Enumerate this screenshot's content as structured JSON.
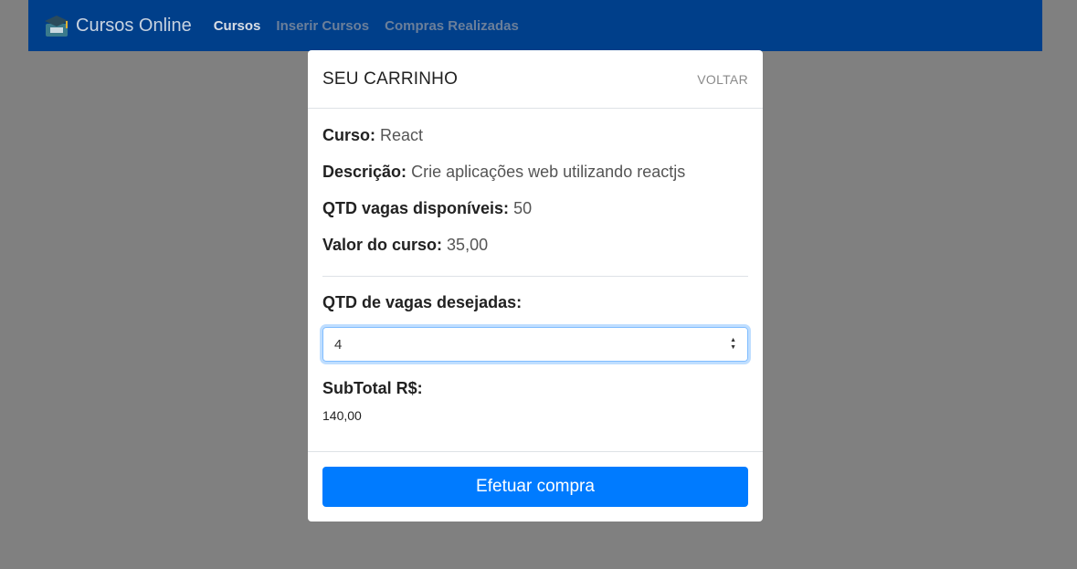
{
  "navbar": {
    "brand": "Cursos Online",
    "links": [
      "Cursos",
      "Inserir Cursos",
      "Compras Realizadas"
    ]
  },
  "modal": {
    "title": "SEU CARRINHO",
    "back_label": "VOLTAR",
    "course_label": "Curso:",
    "course_value": "React",
    "description_label": "Descrição:",
    "description_value": "Crie aplicações web utilizando reactjs",
    "seats_label": "QTD vagas disponíveis:",
    "seats_value": "50",
    "price_label": "Valor do curso:",
    "price_value": "35,00",
    "qty_label": "QTD de vagas desejadas:",
    "qty_value": "4",
    "subtotal_label": "SubTotal R$:",
    "subtotal_value": "140,00",
    "buy_label": "Efetuar compra"
  },
  "colors": {
    "navbar": "#003f8a",
    "primary": "#007bff",
    "backdrop": "#808080"
  }
}
